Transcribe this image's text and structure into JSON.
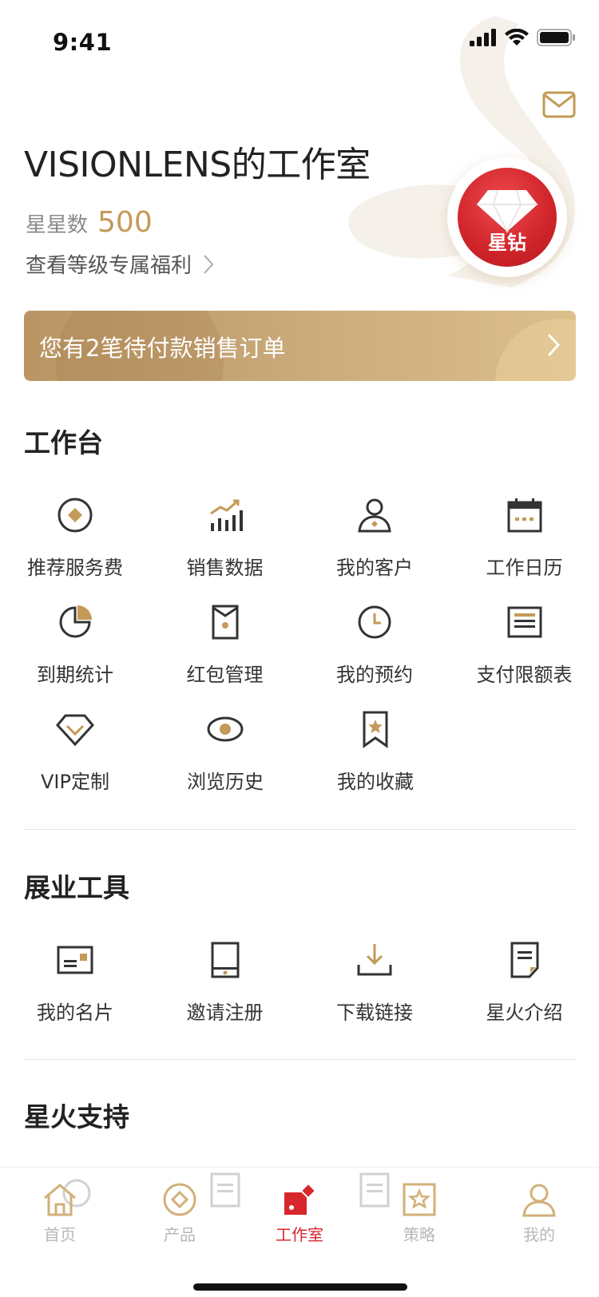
{
  "status_bar": {
    "time": "9:41"
  },
  "header": {
    "studio_title": "VISIONLENS的工作室",
    "stars_label": "星星数",
    "stars_value": "500",
    "benefits_link": "查看等级专属福利",
    "level_badge": "星钻"
  },
  "banner": {
    "text": "您有2笔待付款销售订单"
  },
  "workbench": {
    "title": "工作台",
    "items": [
      {
        "label": "推荐服务费",
        "icon": "coin-icon"
      },
      {
        "label": "销售数据",
        "icon": "sales-chart-icon"
      },
      {
        "label": "我的客户",
        "icon": "customer-icon"
      },
      {
        "label": "工作日历",
        "icon": "calendar-icon"
      },
      {
        "label": "到期统计",
        "icon": "pie-chart-icon"
      },
      {
        "label": "红包管理",
        "icon": "red-packet-icon"
      },
      {
        "label": "我的预约",
        "icon": "clock-icon"
      },
      {
        "label": "支付限额表",
        "icon": "table-icon"
      },
      {
        "label": "VIP定制",
        "icon": "diamond-icon"
      },
      {
        "label": "浏览历史",
        "icon": "eye-icon"
      },
      {
        "label": "我的收藏",
        "icon": "bookmark-icon"
      }
    ]
  },
  "tools": {
    "title": "展业工具",
    "items": [
      {
        "label": "我的名片",
        "icon": "business-card-icon"
      },
      {
        "label": "邀请注册",
        "icon": "tablet-icon"
      },
      {
        "label": "下载链接",
        "icon": "download-icon"
      },
      {
        "label": "星火介绍",
        "icon": "document-icon"
      }
    ]
  },
  "support": {
    "title": "星火支持"
  },
  "tabbar": {
    "tabs": [
      {
        "label": "首页",
        "icon": "home-icon"
      },
      {
        "label": "产品",
        "icon": "product-icon"
      },
      {
        "label": "工作室",
        "icon": "studio-icon",
        "active": true
      },
      {
        "label": "策略",
        "icon": "strategy-icon"
      },
      {
        "label": "我的",
        "icon": "profile-icon"
      }
    ]
  },
  "colors": {
    "gold": "#c39a57",
    "icon_dark": "#333333",
    "active_red": "#d8272c",
    "badge_red": "#d1262c"
  }
}
